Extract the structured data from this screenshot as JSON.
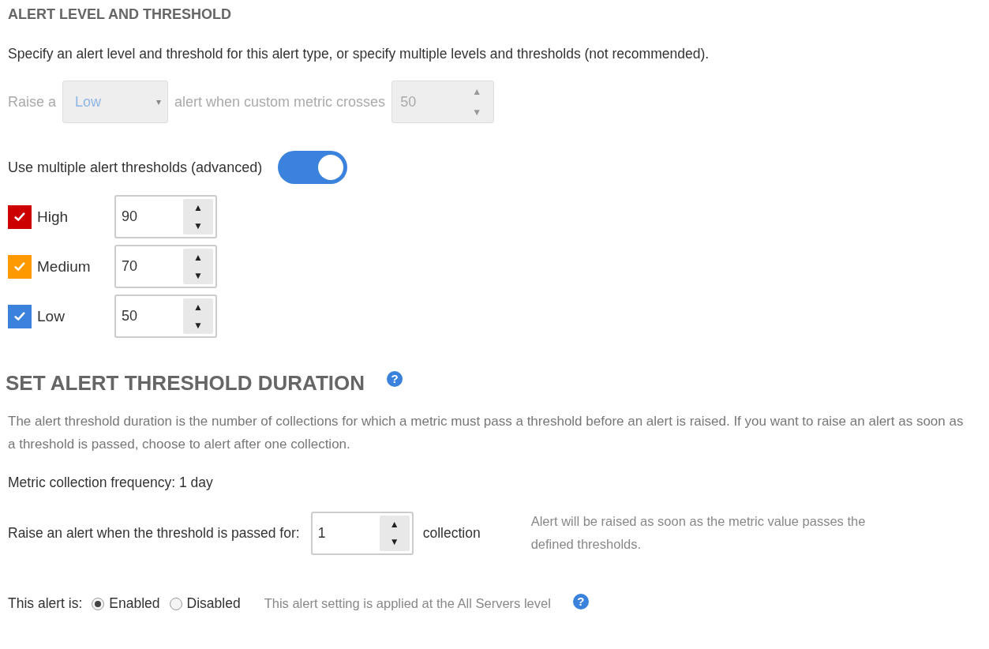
{
  "level_section": {
    "title": "ALERT LEVEL AND THRESHOLD",
    "description": "Specify an alert level and threshold for this alert type, or specify multiple levels and thresholds (not recommended).",
    "single": {
      "disabled": true,
      "prefix": "Raise a",
      "level": "Low",
      "caret": "▾",
      "middle": "alert when custom metric crosses",
      "value": "50",
      "up": "▲",
      "down": "▼"
    },
    "multiple": {
      "label": "Use multiple alert thresholds (advanced)",
      "on": true
    },
    "thresholds": [
      {
        "label": "High",
        "checked": true,
        "color": "#cc0000",
        "value": "90",
        "up": "▲",
        "down": "▼"
      },
      {
        "label": "Medium",
        "checked": true,
        "color": "#ff9900",
        "value": "70",
        "up": "▲",
        "down": "▼"
      },
      {
        "label": "Low",
        "checked": true,
        "color": "#3b82dc",
        "value": "50",
        "up": "▲",
        "down": "▼"
      }
    ]
  },
  "duration_section": {
    "title": "SET ALERT THRESHOLD DURATION",
    "help": "?",
    "description": "The alert threshold duration is the number of collections for which a metric must pass a threshold before an alert is raised. If you want to raise an alert as soon as a threshold is passed, choose to alert after one collection.",
    "frequency": "Metric collection frequency: 1 day",
    "raise_label": "Raise an alert when the threshold is passed for:",
    "value": "1",
    "up": "▲",
    "down": "▼",
    "unit": "collection",
    "note": "Alert will be raised as soon as the metric value passes the defined thresholds."
  },
  "status": {
    "label": "This alert is:",
    "options": [
      {
        "label": "Enabled",
        "selected": true
      },
      {
        "label": "Disabled",
        "selected": false
      }
    ],
    "note": "This alert setting is applied at the All Servers level",
    "help": "?"
  }
}
